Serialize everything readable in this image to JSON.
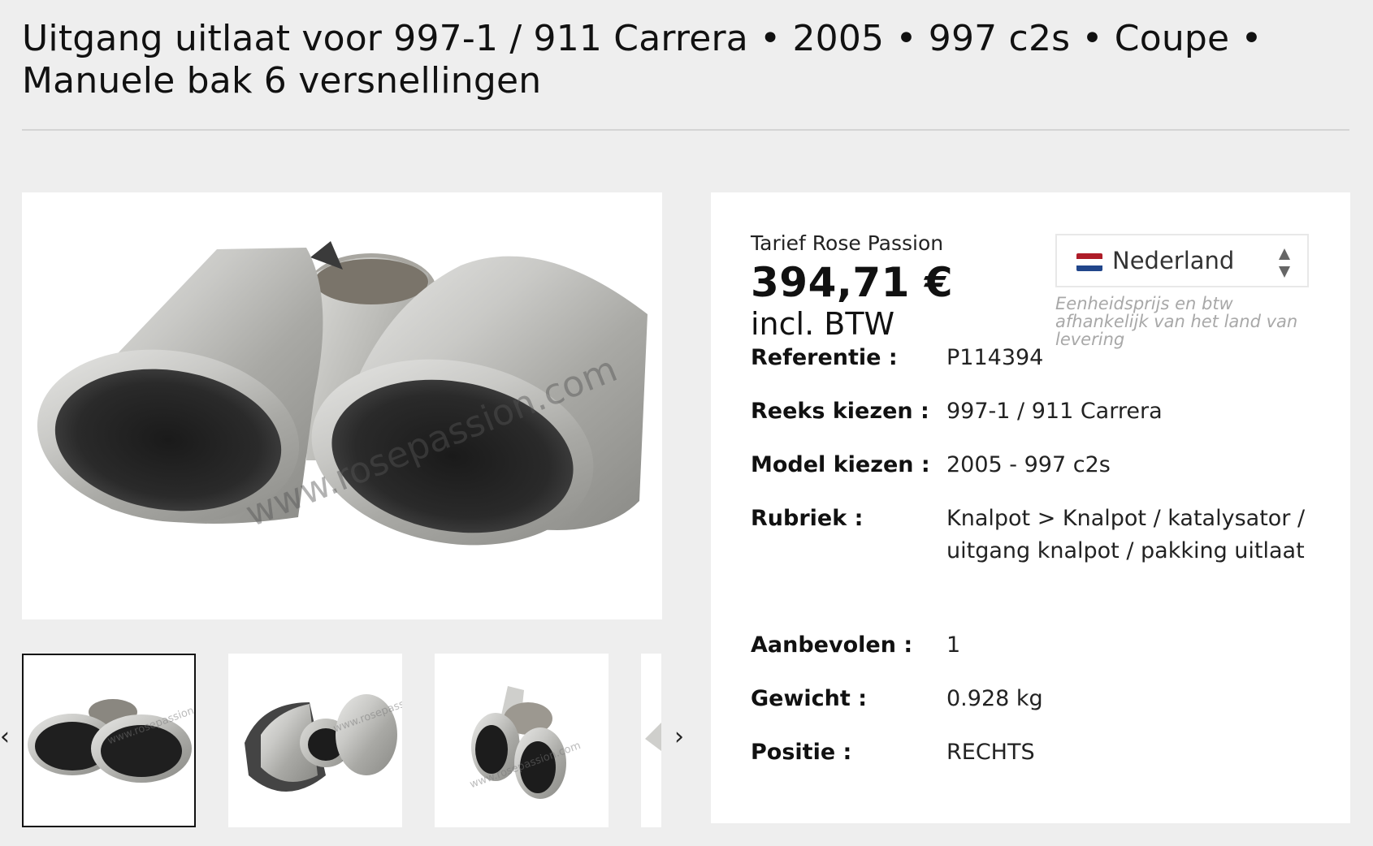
{
  "page": {
    "title": "Uitgang uitlaat voor 997-1 / 911 Carrera • 2005 • 997 c2s • Coupe • Manuele bak 6 versnellingen"
  },
  "gallery": {
    "watermark": "www.rosepassion.com",
    "thumb_watermark": "www.rosepassion.com",
    "prev_arrow": "‹",
    "next_arrow": "›"
  },
  "pricing": {
    "tariff_label": "Tarief Rose Passion",
    "price": "394,71 €",
    "vat_label": "incl. BTW"
  },
  "country_select": {
    "selected": "Nederland",
    "flag_colors": [
      "#ae1c28",
      "#ffffff",
      "#21468b"
    ],
    "note": "Eenheidsprijs en btw afhankelijk van het land van levering"
  },
  "specs": [
    {
      "label": "Referentie :",
      "value": "P114394"
    },
    {
      "label": "Reeks kiezen :",
      "value": "997-1 / 911 Carrera"
    },
    {
      "label": "Model kiezen :",
      "value": "2005 - 997 c2s"
    },
    {
      "label": "Rubriek :",
      "value": "Knalpot > Knalpot / katalysator / uitgang knalpot / pakking uitlaat"
    },
    {
      "label": "Aanbevolen :",
      "value": "1"
    },
    {
      "label": "Gewicht :",
      "value": "0.928 kg"
    },
    {
      "label": "Positie :",
      "value": "RECHTS"
    }
  ]
}
